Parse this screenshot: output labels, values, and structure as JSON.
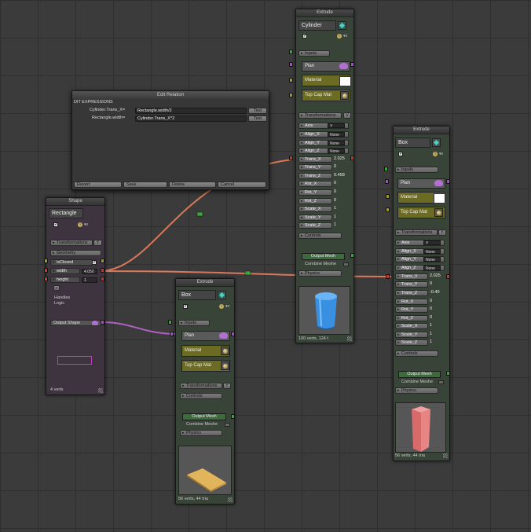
{
  "colors": {
    "canvas": "#3b3b3b",
    "wire_orange": "#d9785a",
    "wire_purple": "#b060c0",
    "node_green": "#394438",
    "node_purple": "#3e3440",
    "socket_red": "#c0392b",
    "socket_green": "#3aa63a"
  },
  "edit_relation": {
    "title": "Edit Relation",
    "heading": "DIT EXPRESSIONS",
    "rows": [
      {
        "label": "Cylinder.Trans_X=",
        "expr": "Rectangle.width/2",
        "btn": "Test"
      },
      {
        "label": "Rectangle.width=",
        "expr": "Cylinder.Trans_X*2",
        "btn": "Test"
      }
    ],
    "buttons": {
      "revert": "Revert",
      "save": "Save",
      "delete": "Delete",
      "cancel": "Cancel"
    }
  },
  "shape_node": {
    "title": "Shape",
    "name": "Rectangle",
    "transformations": "Transformations",
    "transformations_btn": "Y",
    "geometry": "Geometry",
    "is_closed": "isClosed",
    "width_label": "width",
    "width_value": "4.050",
    "height_label": "height",
    "height_value": "1",
    "plus": "+",
    "handles": "Handles",
    "logic": "Logic",
    "output_shape": "Output Shape",
    "footer": "4 verts"
  },
  "extrude_cylinder": {
    "title": "Extrude",
    "name": "Cylinder",
    "inputs": "Inputs",
    "plan": "Plan",
    "material": "Material",
    "top_cap": "Top Cap Mat",
    "transformations": "Transformations",
    "transformations_btn": "V",
    "params": [
      {
        "label": "Axis",
        "value": "Y"
      },
      {
        "label": "Align_X",
        "value": "None"
      },
      {
        "label": "Align_Y",
        "value": "None"
      },
      {
        "label": "Align_Z",
        "value": "None"
      },
      {
        "label": "Trans_X",
        "value": "2.025"
      },
      {
        "label": "Trans_Y",
        "value": "0"
      },
      {
        "label": "Trans_Z",
        "value": "0.458"
      },
      {
        "label": "Rot_X",
        "value": "0"
      },
      {
        "label": "Rot_Y",
        "value": "0"
      },
      {
        "label": "Rot_Z",
        "value": "0"
      },
      {
        "label": "Scale_X",
        "value": "1"
      },
      {
        "label": "Scale_Y",
        "value": "1"
      },
      {
        "label": "Scale_Z",
        "value": "1"
      }
    ],
    "controls": "Controls",
    "output_mesh": "Output Mesh",
    "combine": "Combine Meshe",
    "physics": "Physics",
    "footer": "100 verts, 124 t"
  },
  "extrude_box_right": {
    "title": "Extrude",
    "name": "Box",
    "inputs": "Inputs",
    "plan": "Plan",
    "material": "Material",
    "top_cap": "Top Cap Mat",
    "transformations": "Transformations",
    "transformations_btn": "Y",
    "params": [
      {
        "label": "Axis",
        "value": "Y"
      },
      {
        "label": "Align_X",
        "value": "None"
      },
      {
        "label": "Align_Y",
        "value": "None"
      },
      {
        "label": "Align_Z",
        "value": "None"
      },
      {
        "label": "Trans_X",
        "value": "2.025"
      },
      {
        "label": "Trans_Y",
        "value": "0"
      },
      {
        "label": "Trans_Z",
        "value": "-0.40"
      },
      {
        "label": "Rot_X",
        "value": "0"
      },
      {
        "label": "Rot_Y",
        "value": "0"
      },
      {
        "label": "Rot_Z",
        "value": "0"
      },
      {
        "label": "Scale_X",
        "value": "1"
      },
      {
        "label": "Scale_Y",
        "value": "1"
      },
      {
        "label": "Scale_Z",
        "value": "1"
      }
    ],
    "controls": "Controls",
    "output_mesh": "Output Mesh",
    "combine": "Combine Meshe",
    "physics": "Physics",
    "footer": "56 verts, 44 tria"
  },
  "extrude_box_mid": {
    "title": "Extrude",
    "name": "Box",
    "inputs": "Inputs",
    "plan": "Plan",
    "material": "Material",
    "top_cap": "Top Cap Mat",
    "transformations": "Transformations",
    "transformations_btn": "Y",
    "controls": "Controls",
    "output_mesh": "Output Mesh",
    "combine": "Combine Meshe",
    "physics": "Physics",
    "footer": "56 verts, 44 tria"
  }
}
